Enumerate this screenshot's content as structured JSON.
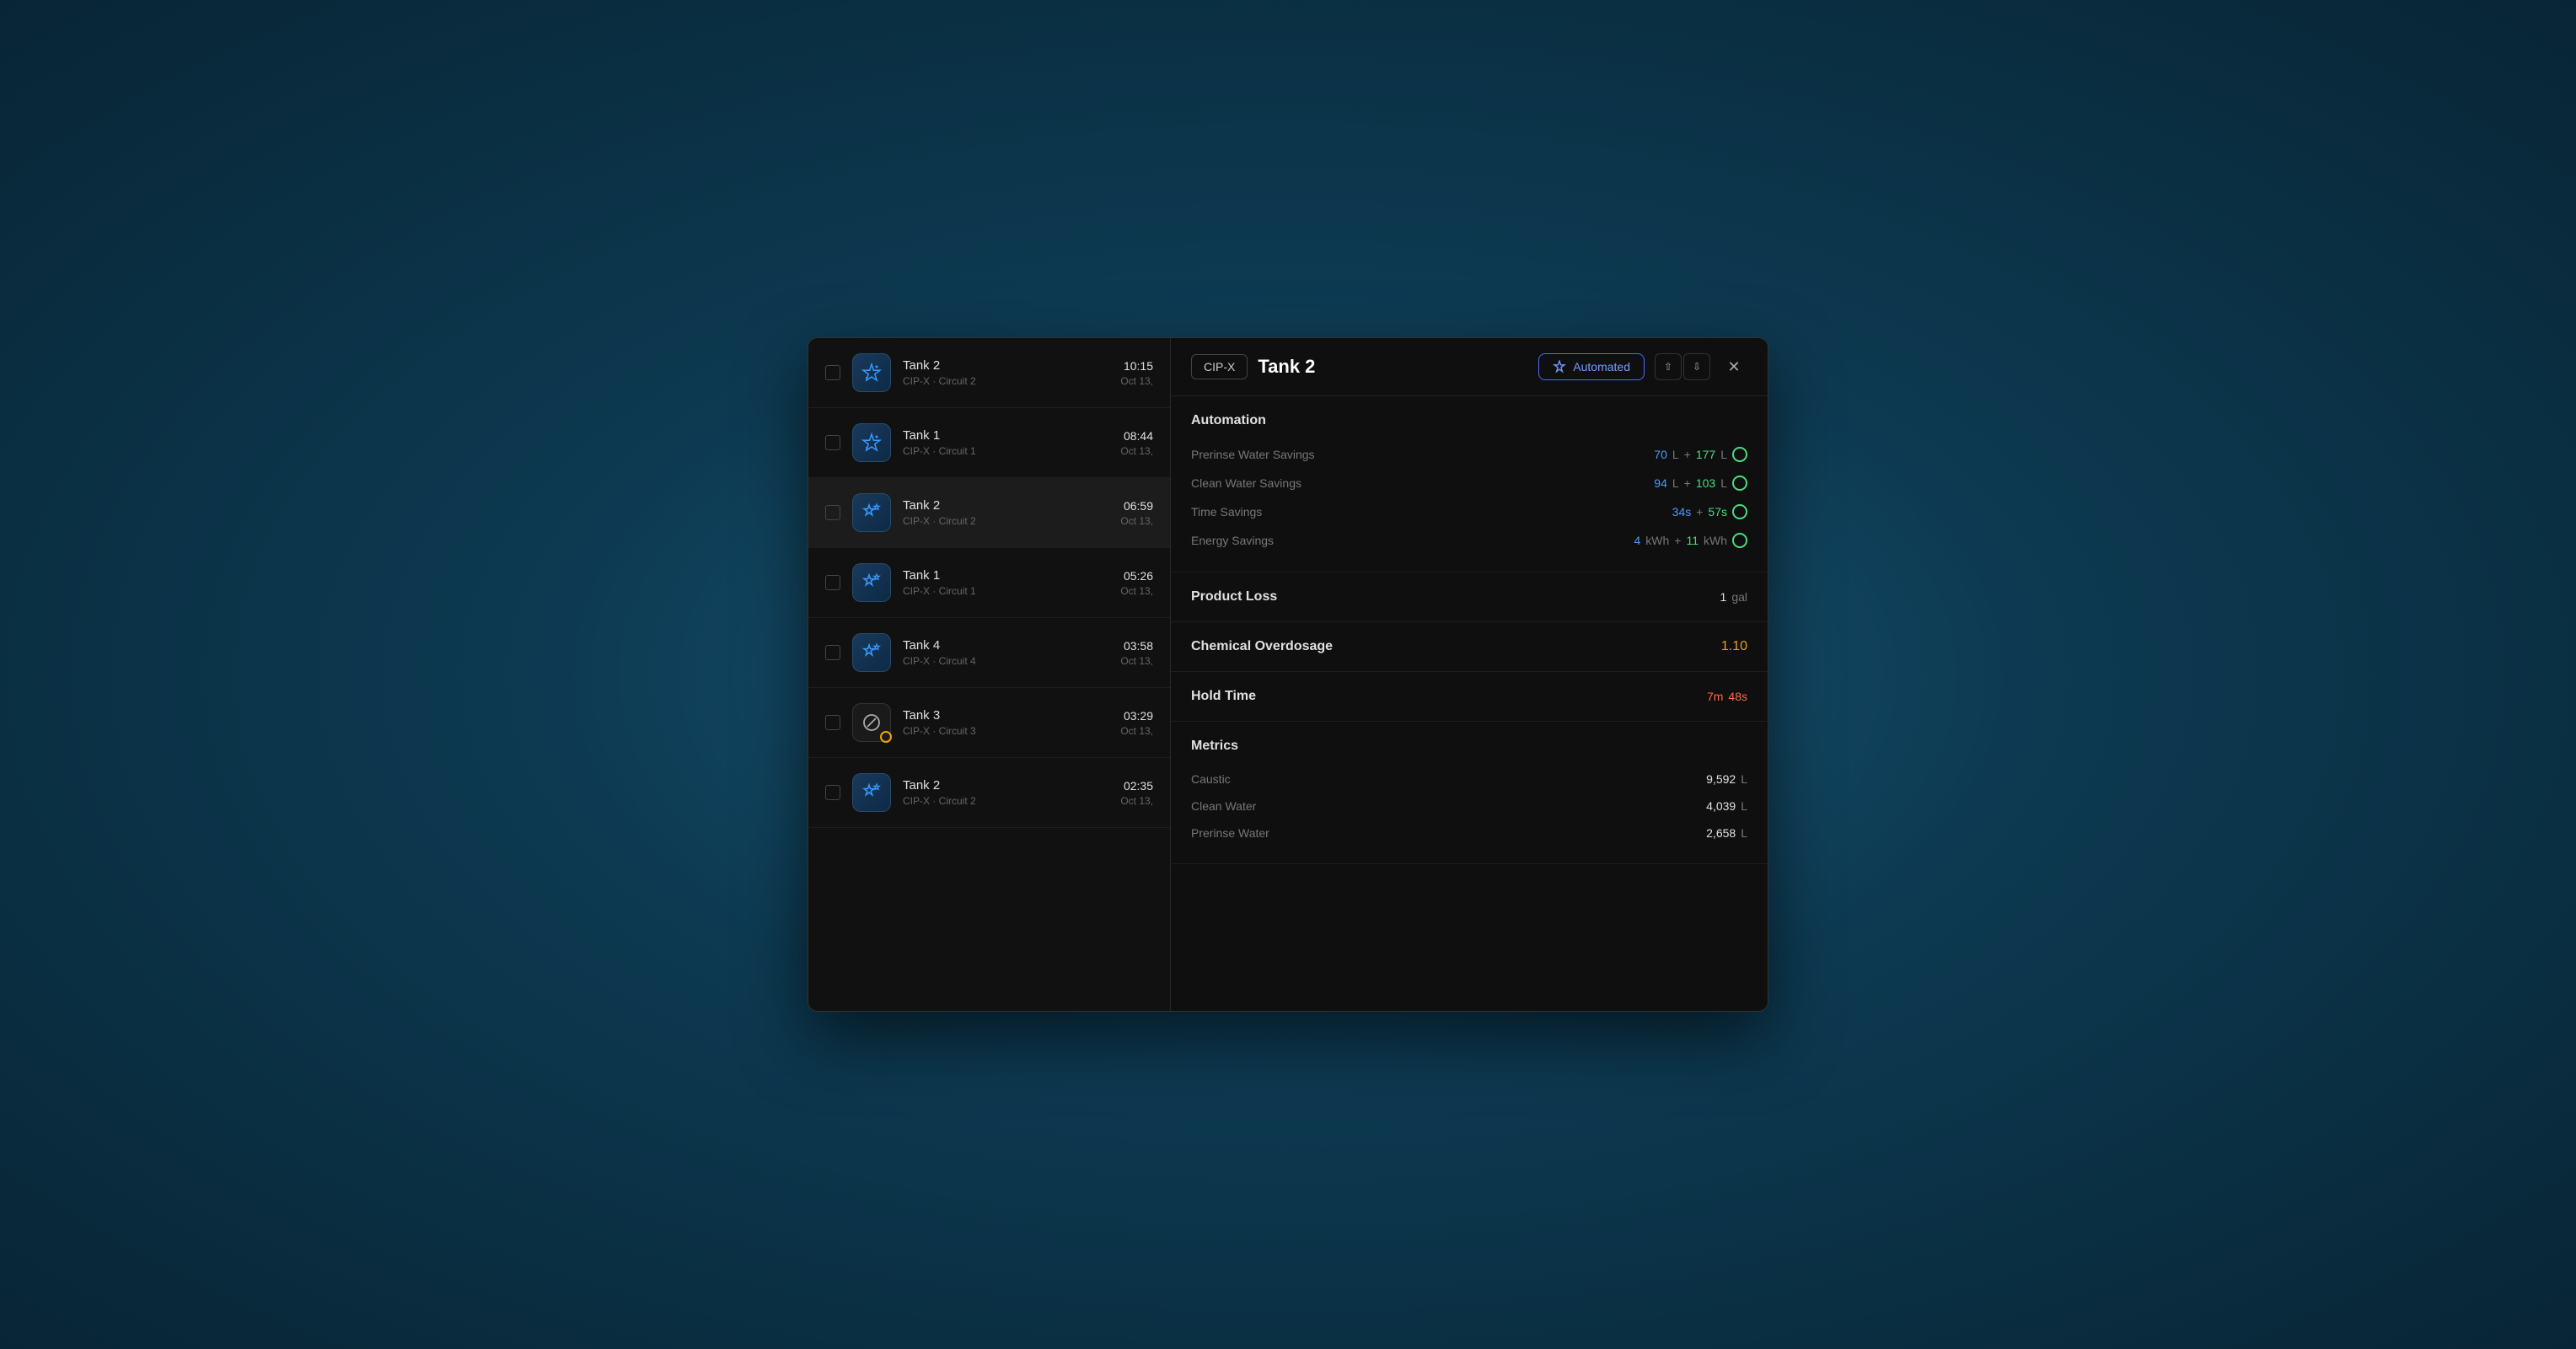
{
  "leftPanel": {
    "items": [
      {
        "id": "item-1",
        "name": "Tank  2",
        "sub": "CIP-X · Circuit 2",
        "time": "10:15",
        "date": "Oct 13,",
        "iconType": "blue-gradient",
        "iconStyle": "sparkles",
        "active": false
      },
      {
        "id": "item-2",
        "name": "Tank  1",
        "sub": "CIP-X · Circuit 1",
        "time": "08:44",
        "date": "Oct 13,",
        "iconType": "blue-gradient",
        "iconStyle": "sparkles",
        "active": false
      },
      {
        "id": "item-3",
        "name": "Tank  2",
        "sub": "CIP-X · Circuit 2",
        "time": "06:59",
        "date": "Oct 13,",
        "iconType": "blue-gradient",
        "iconStyle": "sparkles-small",
        "active": true
      },
      {
        "id": "item-4",
        "name": "Tank  1",
        "sub": "CIP-X · Circuit 1",
        "time": "05:26",
        "date": "Oct 13,",
        "iconType": "blue-gradient",
        "iconStyle": "sparkles-small",
        "active": false
      },
      {
        "id": "item-5",
        "name": "Tank  4",
        "sub": "CIP-X · Circuit 4",
        "time": "03:58",
        "date": "Oct 13,",
        "iconType": "blue-gradient",
        "iconStyle": "sparkles-small",
        "active": false
      },
      {
        "id": "item-6",
        "name": "Tank  3",
        "sub": "CIP-X · Circuit 3",
        "time": "03:29",
        "date": "Oct 13,",
        "iconType": "dark-gray",
        "iconStyle": "cancel",
        "warning": true,
        "active": false
      },
      {
        "id": "item-7",
        "name": "Tank  2",
        "sub": "CIP-X · Circuit 2",
        "time": "02:35",
        "date": "Oct 13,",
        "iconType": "blue-gradient",
        "iconStyle": "sparkles-small",
        "active": false
      }
    ]
  },
  "rightPanel": {
    "tag": "CIP-X",
    "title": "Tank 2",
    "automatedLabel": "Automated",
    "sections": {
      "automation": {
        "title": "Automation",
        "rows": [
          {
            "label": "Prerinse Water Savings",
            "val1": "70",
            "unit1": "L",
            "val2": "177",
            "unit2": "L",
            "hasCircle": true
          },
          {
            "label": "Clean Water Savings",
            "val1": "94",
            "unit1": "L",
            "val2": "103",
            "unit2": "L",
            "hasCircle": true
          },
          {
            "label": "Time Savings",
            "val1": "34s",
            "unit1": "",
            "val2": "57s",
            "unit2": "",
            "hasCircle": true
          },
          {
            "label": "Energy Savings",
            "val1": "4",
            "unit1": "kWh",
            "val2": "11",
            "unit2": "kWh",
            "hasCircle": true
          }
        ]
      },
      "productLoss": {
        "label": "Product Loss",
        "value": "1",
        "unit": "gal"
      },
      "chemicalOverdosage": {
        "label": "Chemical Overdosage",
        "value": "1.10"
      },
      "holdTime": {
        "label": "Hold Time",
        "val1": "7m",
        "val2": "48s"
      },
      "metrics": {
        "title": "Metrics",
        "rows": [
          {
            "label": "Caustic",
            "value": "9,592",
            "unit": "L"
          },
          {
            "label": "Clean Water",
            "value": "4,039",
            "unit": "L"
          },
          {
            "label": "Prerinse Water",
            "value": "2,658",
            "unit": "L"
          }
        ]
      }
    }
  }
}
